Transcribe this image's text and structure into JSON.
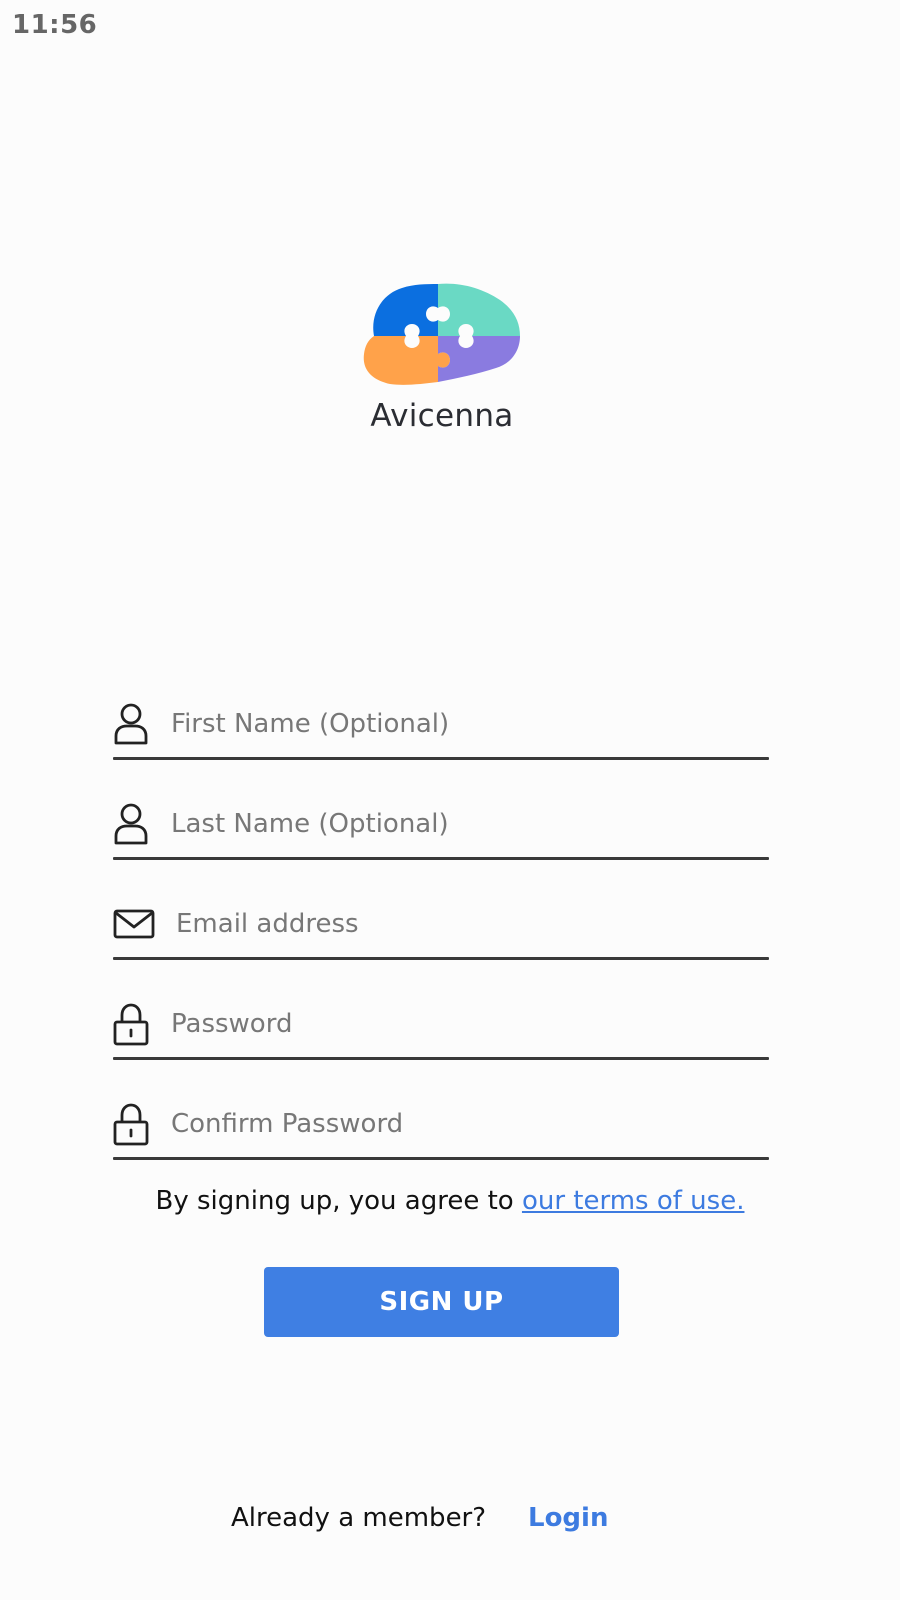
{
  "status_bar": {
    "time": "11:56"
  },
  "logo": {
    "name": "Avicenna",
    "icon": "puzzle-brain-icon"
  },
  "form": {
    "first_name": {
      "placeholder": "First Name (Optional)",
      "icon": "person-icon"
    },
    "last_name": {
      "placeholder": "Last Name (Optional)",
      "icon": "person-icon"
    },
    "email": {
      "placeholder": "Email address",
      "icon": "envelope-icon"
    },
    "password": {
      "placeholder": "Password",
      "icon": "lock-icon"
    },
    "confirm_password": {
      "placeholder": "Confirm Password",
      "icon": "lock-icon"
    }
  },
  "terms": {
    "prefix": "By signing up, you agree to ",
    "link_text": "our terms of use."
  },
  "signup_button": {
    "label": "SIGN UP",
    "color": "#3f7fe3"
  },
  "footer": {
    "prompt": "Already a member?",
    "login_label": "Login",
    "link_color": "#3d7be0"
  }
}
